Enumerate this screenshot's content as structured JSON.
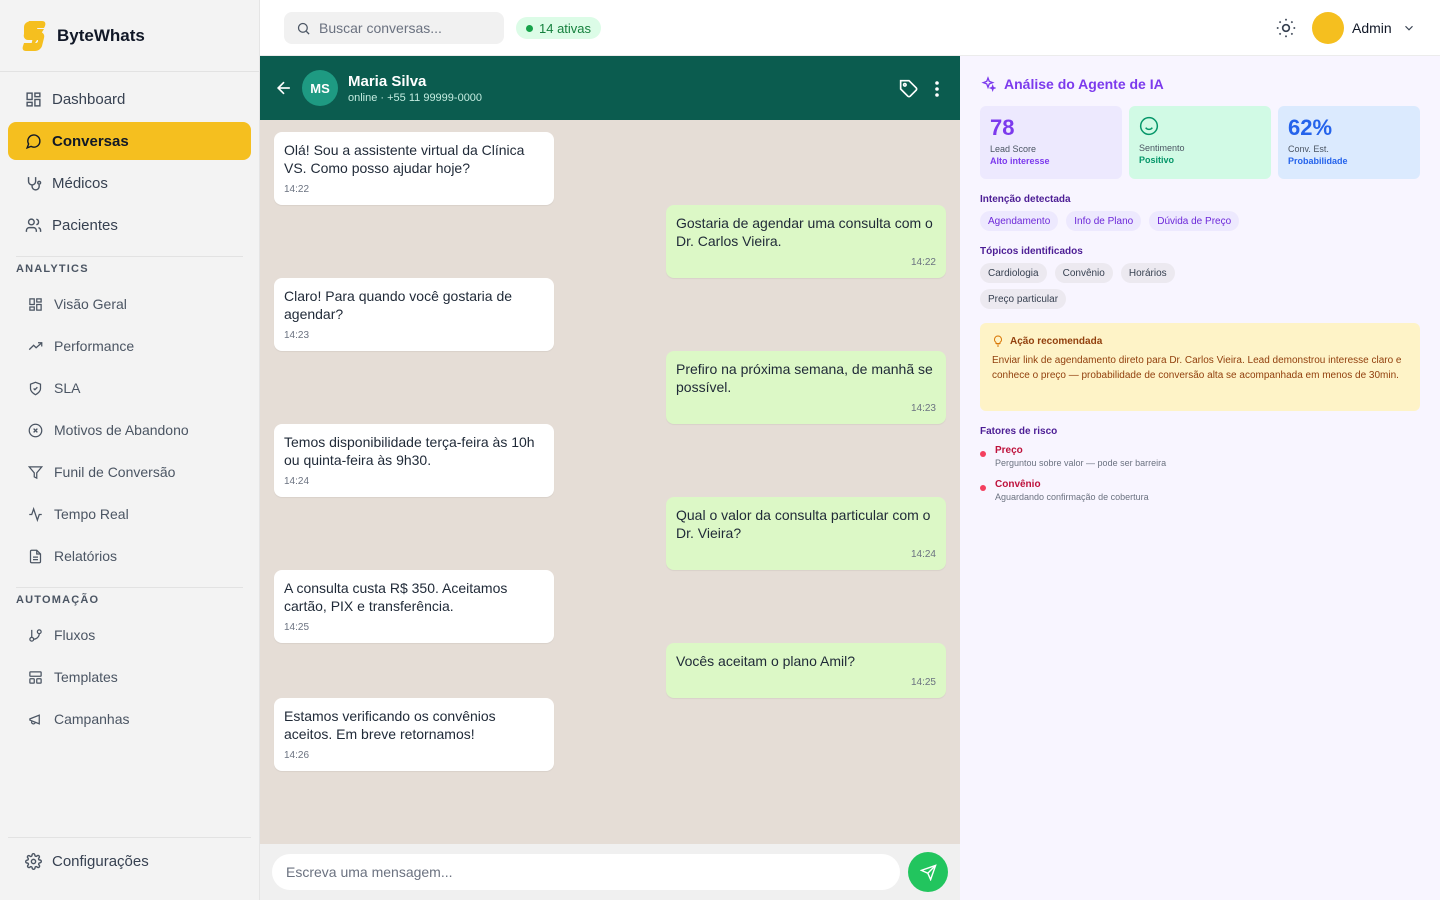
{
  "brand": {
    "name": "ByteWhats"
  },
  "sidebar": {
    "main_items": [
      {
        "label": "Dashboard",
        "icon": "dashboard-icon"
      },
      {
        "label": "Conversas",
        "icon": "chat-icon",
        "active": true
      },
      {
        "label": "Médicos",
        "icon": "stethoscope-icon"
      },
      {
        "label": "Pacientes",
        "icon": "users-icon"
      }
    ],
    "analytics_label": "ANALYTICS",
    "analytics_items": [
      {
        "label": "Visão Geral",
        "icon": "grid-icon"
      },
      {
        "label": "Performance",
        "icon": "trending-up-icon"
      },
      {
        "label": "SLA",
        "icon": "shield-icon"
      },
      {
        "label": "Motivos de Abandono",
        "icon": "x-circle-icon"
      },
      {
        "label": "Funil de Conversão",
        "icon": "filter-icon"
      },
      {
        "label": "Tempo Real",
        "icon": "activity-icon"
      },
      {
        "label": "Relatórios",
        "icon": "file-text-icon"
      }
    ],
    "automation_label": "AUTOMAÇÃO",
    "automation_items": [
      {
        "label": "Fluxos",
        "icon": "git-branch-icon"
      },
      {
        "label": "Templates",
        "icon": "layout-icon"
      },
      {
        "label": "Campanhas",
        "icon": "megaphone-icon"
      }
    ],
    "settings_label": "Configurações"
  },
  "topbar": {
    "search_placeholder": "Buscar conversas...",
    "active_badge": "14 ativas",
    "user_name": "Admin"
  },
  "chat": {
    "contact_initials": "MS",
    "contact_name": "Maria Silva",
    "contact_status": "online · +55 11 99999-0000",
    "messages": [
      {
        "dir": "in",
        "text": "Olá! Sou a assistente virtual da Clínica VS. Como posso ajudar hoje?",
        "time": "14:22"
      },
      {
        "dir": "out",
        "text": "Gostaria de agendar uma consulta com o Dr. Carlos Vieira.",
        "time": "14:22"
      },
      {
        "dir": "in",
        "text": "Claro! Para quando você gostaria de agendar?",
        "time": "14:23"
      },
      {
        "dir": "out",
        "text": "Prefiro na próxima semana, de manhã se possível.",
        "time": "14:23"
      },
      {
        "dir": "in",
        "text": "Temos disponibilidade terça-feira às 10h ou quinta-feira às 9h30.",
        "time": "14:24"
      },
      {
        "dir": "out",
        "text": "Qual o valor da consulta particular com o Dr. Vieira?",
        "time": "14:24"
      },
      {
        "dir": "in",
        "text": "A consulta custa R$ 350. Aceitamos cartão, PIX e transferência.",
        "time": "14:25"
      },
      {
        "dir": "out",
        "text": "Vocês aceitam o plano Amil?",
        "time": "14:25"
      },
      {
        "dir": "in",
        "text": "Estamos verificando os convênios aceitos. Em breve retornamos!",
        "time": "14:26"
      }
    ],
    "composer_placeholder": "Escreva uma mensagem..."
  },
  "ai": {
    "title": "Análise do Agente de IA",
    "lead_score": {
      "value": "78",
      "label": "Lead Score",
      "sub": "Alto interesse"
    },
    "sentiment": {
      "label": "Sentimento",
      "sub": "Positivo"
    },
    "conversion": {
      "value": "62%",
      "label": "Conv. Est.",
      "sub": "Probabilidade"
    },
    "intent_label": "Intenção detectada",
    "intents": [
      "Agendamento",
      "Info de Plano",
      "Dúvida de Preço"
    ],
    "topics_label": "Tópicos identificados",
    "topics": [
      "Cardiologia",
      "Convênio",
      "Horários",
      "Preço particular"
    ],
    "action_title": "Ação recomendada",
    "action_text": "Enviar link de agendamento direto para Dr. Carlos Vieira. Lead demonstrou interesse claro e conhece o preço — probabilidade de conversão alta se acompanhada em menos de 30min.",
    "risk_label": "Fatores de risco",
    "risks": [
      {
        "name": "Preço",
        "desc": "Perguntou sobre valor — pode ser barreira"
      },
      {
        "name": "Convênio",
        "desc": "Aguardando confirmação de cobertura"
      }
    ]
  },
  "colors": {
    "accent": "#f5bf1f",
    "chat_header": "#0b5c4f",
    "ai_purple": "#7c3aed"
  }
}
